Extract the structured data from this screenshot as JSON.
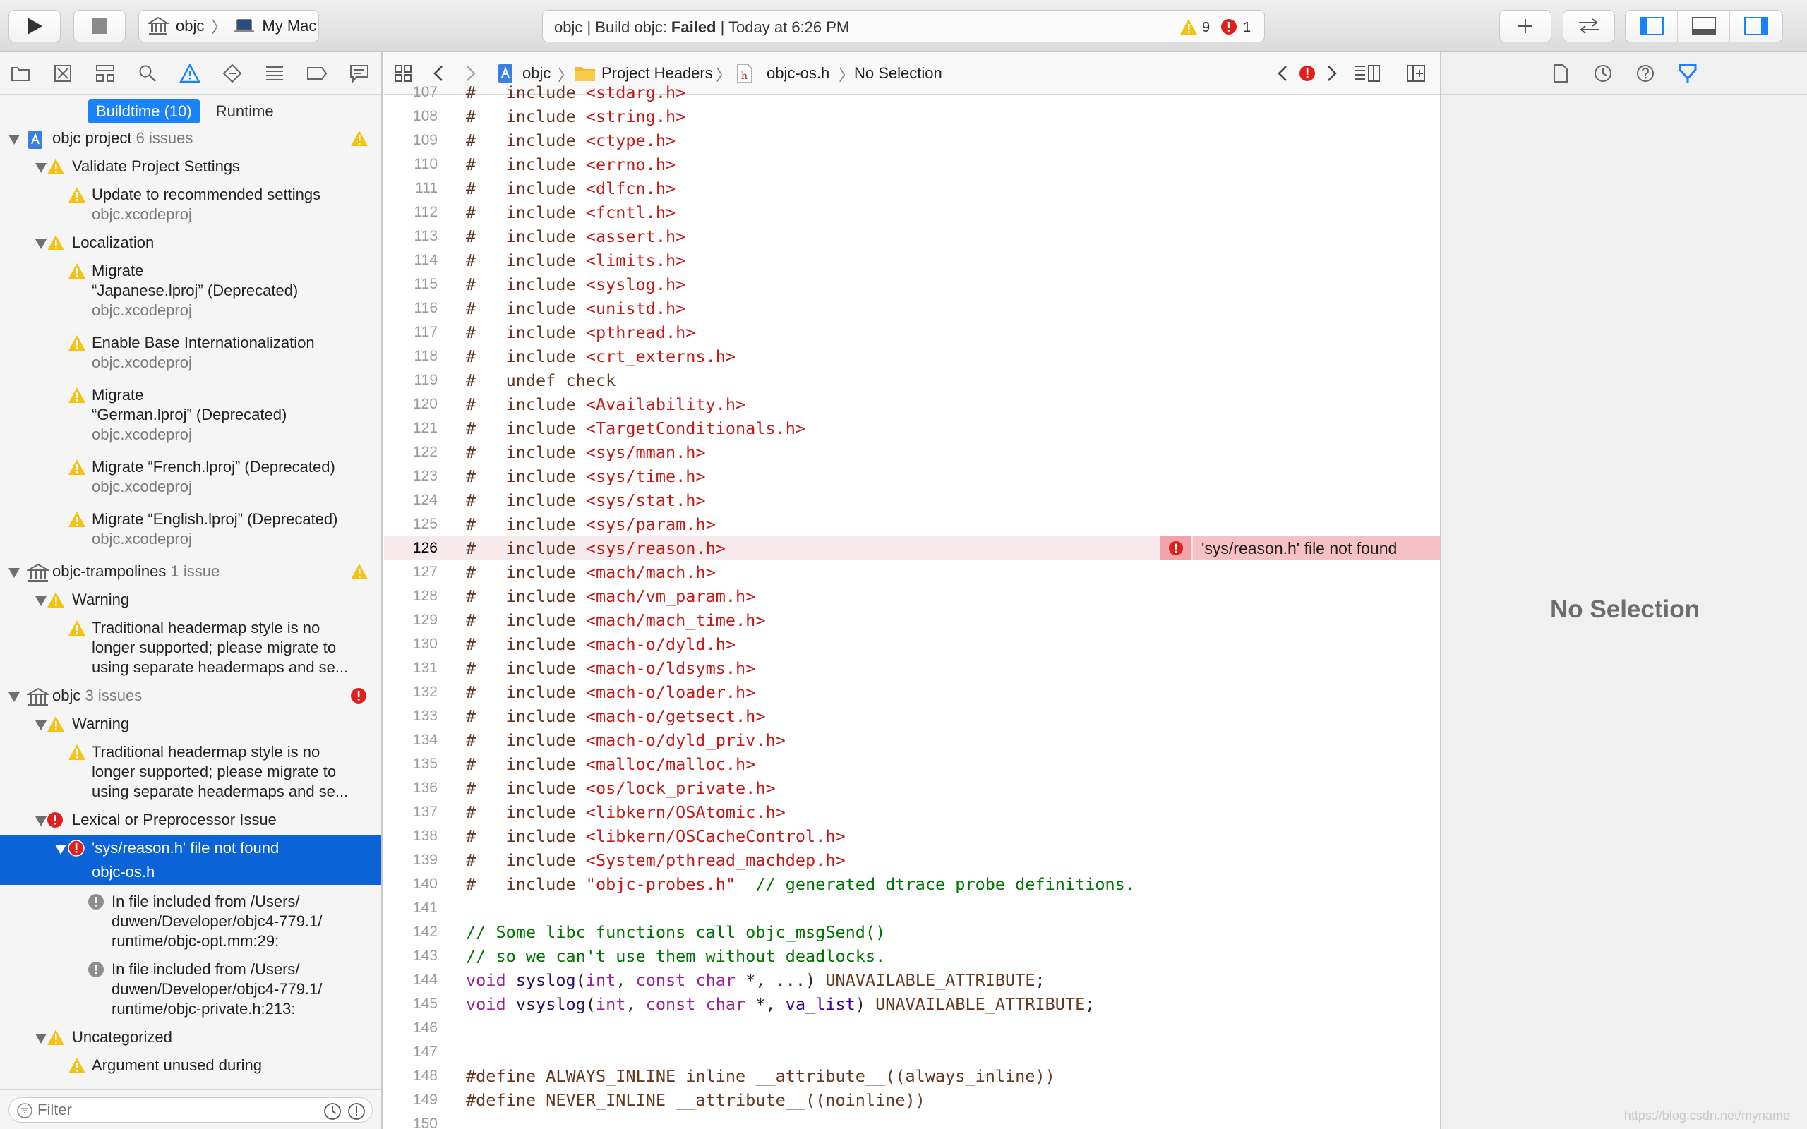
{
  "toolbar": {
    "scheme_name": "objc",
    "destination": "My Mac",
    "status_prefix": "objc | Build objc: ",
    "status_result": "Failed",
    "status_suffix": " | Today at 6:26 PM",
    "warning_count": "9",
    "error_count": "1"
  },
  "navigator": {
    "toggle_buildtime": "Buildtime (10)",
    "toggle_runtime": "Runtime",
    "filter_placeholder": "Filter",
    "rows": [
      {
        "label": "objc project",
        "sub": " 6 issues"
      },
      {
        "label": "Validate Project Settings"
      },
      {
        "label": "Update to recommended settings"
      },
      {
        "label": "objc.xcodeproj"
      },
      {
        "label": "Localization"
      },
      {
        "label": "Migrate"
      },
      {
        "label": "“Japanese.lproj” (Deprecated)"
      },
      {
        "label": "objc.xcodeproj"
      },
      {
        "label": "Enable Base Internationalization"
      },
      {
        "label": "objc.xcodeproj"
      },
      {
        "label": "Migrate"
      },
      {
        "label": "“German.lproj” (Deprecated)"
      },
      {
        "label": "objc.xcodeproj"
      },
      {
        "label": "Migrate “French.lproj” (Deprecated)"
      },
      {
        "label": "objc.xcodeproj"
      },
      {
        "label": "Migrate “English.lproj” (Deprecated)"
      },
      {
        "label": "objc.xcodeproj"
      },
      {
        "label": "objc-trampolines",
        "sub": " 1 issue"
      },
      {
        "label": "Warning"
      },
      {
        "label": "Traditional headermap style is no"
      },
      {
        "label": "longer supported; please migrate to"
      },
      {
        "label": "using separate headermaps and se..."
      },
      {
        "label": "objc",
        "sub": " 3 issues"
      },
      {
        "label": "Warning"
      },
      {
        "label": "Traditional headermap style is no"
      },
      {
        "label": "longer supported; please migrate to"
      },
      {
        "label": "using separate headermaps and se..."
      },
      {
        "label": "Lexical or Preprocessor Issue"
      },
      {
        "label": "'sys/reason.h' file not found"
      },
      {
        "label": "objc-os.h"
      },
      {
        "label": "In file included from /Users/"
      },
      {
        "label": "duwen/Developer/objc4-779.1/"
      },
      {
        "label": "runtime/objc-opt.mm:29:"
      },
      {
        "label": "In file included from /Users/"
      },
      {
        "label": "duwen/Developer/objc4-779.1/"
      },
      {
        "label": "runtime/objc-private.h:213:"
      },
      {
        "label": "Uncategorized"
      },
      {
        "label": "Argument unused during"
      }
    ]
  },
  "jumpbar": {
    "project": "objc",
    "group": "Project Headers",
    "file": "objc-os.h",
    "symbol": "No Selection"
  },
  "code": {
    "error_message": "'sys/reason.h' file not found",
    "lines": [
      {
        "n": "107",
        "t": "#   include <stdarg.h>"
      },
      {
        "n": "108",
        "t": "#   include <string.h>"
      },
      {
        "n": "109",
        "t": "#   include <ctype.h>"
      },
      {
        "n": "110",
        "t": "#   include <errno.h>"
      },
      {
        "n": "111",
        "t": "#   include <dlfcn.h>"
      },
      {
        "n": "112",
        "t": "#   include <fcntl.h>"
      },
      {
        "n": "113",
        "t": "#   include <assert.h>"
      },
      {
        "n": "114",
        "t": "#   include <limits.h>"
      },
      {
        "n": "115",
        "t": "#   include <syslog.h>"
      },
      {
        "n": "116",
        "t": "#   include <unistd.h>"
      },
      {
        "n": "117",
        "t": "#   include <pthread.h>"
      },
      {
        "n": "118",
        "t": "#   include <crt_externs.h>"
      },
      {
        "n": "119",
        "t": "#   undef check"
      },
      {
        "n": "120",
        "t": "#   include <Availability.h>"
      },
      {
        "n": "121",
        "t": "#   include <TargetConditionals.h>"
      },
      {
        "n": "122",
        "t": "#   include <sys/mman.h>"
      },
      {
        "n": "123",
        "t": "#   include <sys/time.h>"
      },
      {
        "n": "124",
        "t": "#   include <sys/stat.h>"
      },
      {
        "n": "125",
        "t": "#   include <sys/param.h>"
      },
      {
        "n": "126",
        "t": "#   include <sys/reason.h>"
      },
      {
        "n": "127",
        "t": "#   include <mach/mach.h>"
      },
      {
        "n": "128",
        "t": "#   include <mach/vm_param.h>"
      },
      {
        "n": "129",
        "t": "#   include <mach/mach_time.h>"
      },
      {
        "n": "130",
        "t": "#   include <mach-o/dyld.h>"
      },
      {
        "n": "131",
        "t": "#   include <mach-o/ldsyms.h>"
      },
      {
        "n": "132",
        "t": "#   include <mach-o/loader.h>"
      },
      {
        "n": "133",
        "t": "#   include <mach-o/getsect.h>"
      },
      {
        "n": "134",
        "t": "#   include <mach-o/dyld_priv.h>"
      },
      {
        "n": "135",
        "t": "#   include <malloc/malloc.h>"
      },
      {
        "n": "136",
        "t": "#   include <os/lock_private.h>"
      },
      {
        "n": "137",
        "t": "#   include <libkern/OSAtomic.h>"
      },
      {
        "n": "138",
        "t": "#   include <libkern/OSCacheControl.h>"
      },
      {
        "n": "139",
        "t": "#   include <System/pthread_machdep.h>"
      },
      {
        "n": "140",
        "t": "#   include \"objc-probes.h\"  // generated dtrace probe definitions."
      },
      {
        "n": "141",
        "t": ""
      },
      {
        "n": "142",
        "t": "// Some libc functions call objc_msgSend()"
      },
      {
        "n": "143",
        "t": "// so we can't use them without deadlocks."
      },
      {
        "n": "144",
        "t": "void syslog(int, const char *, ...) UNAVAILABLE_ATTRIBUTE;"
      },
      {
        "n": "145",
        "t": "void vsyslog(int, const char *, va_list) UNAVAILABLE_ATTRIBUTE;"
      },
      {
        "n": "146",
        "t": ""
      },
      {
        "n": "147",
        "t": ""
      },
      {
        "n": "148",
        "t": "#define ALWAYS_INLINE inline __attribute__((always_inline))"
      },
      {
        "n": "149",
        "t": "#define NEVER_INLINE __attribute__((noinline))"
      },
      {
        "n": "150",
        "t": ""
      }
    ]
  },
  "inspector": {
    "empty_label": "No Selection"
  },
  "watermark": "https://blog.csdn.net/myname",
  "colors": {
    "accent": "#1a82fb",
    "selection": "#0a64d8",
    "warning": "#f5c211",
    "error": "#e0201c",
    "error_line_bg": "#f7eaed",
    "error_bubble": "#f6c1c4"
  }
}
